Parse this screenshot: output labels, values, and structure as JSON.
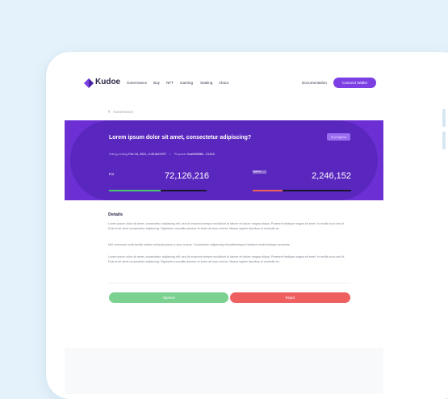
{
  "nav": {
    "brand": "Kudoe",
    "links": [
      "Governance",
      "Buy",
      "NFT",
      "Gaming",
      "Staking",
      "About"
    ],
    "documentation": "Documentation",
    "connect_wallet": "Connect Wallet"
  },
  "breadcrumb": {
    "label": "Governance"
  },
  "proposal": {
    "status": "In progress",
    "title": "Lorem ipsum dolor sit amet, consectetur adipiscing?",
    "voting_label": "Voting ending",
    "voting_end": "Feb 18, 2021, 4:45 AM EST",
    "proposer_label": "Proposer",
    "proposer": "0xa6356f8e...21443",
    "for_label": "For",
    "for_value": "72,126,216",
    "for_share": 0.53,
    "against_label": "Against",
    "against_value": "2,246,152",
    "against_share": 0.3
  },
  "details": {
    "heading": "Details",
    "paragraphs": [
      "Lorem ipsum dolor sit amet, consectetur adipiscing elit, sed do eiusmod tempor incididunt ut labore et dolore magna aliqua. Praesent tristique magna sit amet. In mollis nunc sed id. Duis at sit amet consectetur adipiscing. Dignissim convallis aenean et tortor at risus viverra. Massa sapien faucibus et molestie ac.",
      "Mel commodo nulla facilisi nullam vehicula ipsum a arcu cursus. Consectetur adipiscing elit pellentesque habitant morbi tristique senectus.",
      "Lorem ipsum dolor sit amet, consectetur adipiscing elit, sed do eiusmod tempor incididunt ut labore et dolore magna aliqua. Praesent tristique magna sit amet. In mollis nunc sed id. Duis at sit amet consectetur adipiscing. Dignissim convallis aenean et tortor at risus viverra. Massa sapien faucibus et molestie ac."
    ]
  },
  "actions": {
    "approve": "Approve",
    "reject": "Reject"
  },
  "colors": {
    "accent": "#7b3fe4",
    "banner": "#6c2fd4",
    "for_bar": "#4cc573",
    "against_bar": "#ee5f5f",
    "approve": "#7bd18f",
    "reject": "#ee5f5f"
  }
}
